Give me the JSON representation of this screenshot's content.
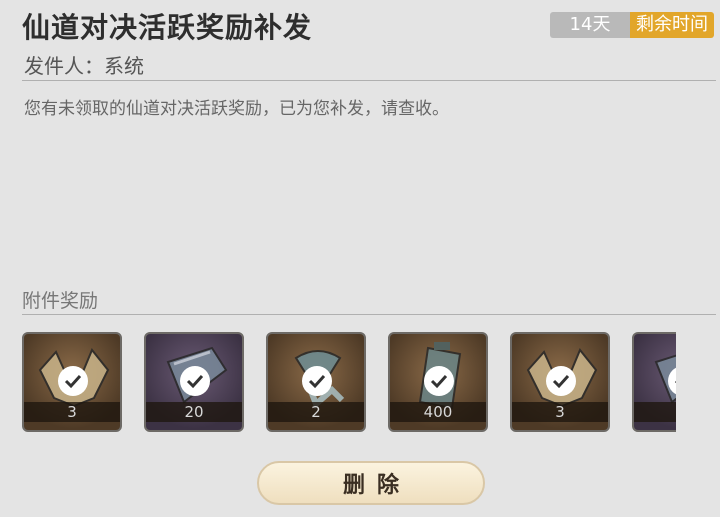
{
  "mail": {
    "title": "仙道对决活跃奖励补发",
    "days": "14天",
    "remaining_label": "剩余时间",
    "sender": "发件人：系统",
    "body": "您有未领取的仙道对决活跃奖励，已为您补发，请查收。"
  },
  "attachments": {
    "label": "附件奖励",
    "items": [
      {
        "qty": "3",
        "icon": "fox-mask-icon",
        "claimed": true
      },
      {
        "qty": "20",
        "icon": "scroll-icon",
        "claimed": true
      },
      {
        "qty": "2",
        "icon": "jade-token-icon",
        "claimed": true
      },
      {
        "qty": "400",
        "icon": "tablet-icon",
        "claimed": true
      },
      {
        "qty": "3",
        "icon": "fox-mask-icon",
        "claimed": true
      },
      {
        "qty": "",
        "icon": "scroll-icon",
        "claimed": true
      }
    ]
  },
  "actions": {
    "delete_label": "删除"
  }
}
